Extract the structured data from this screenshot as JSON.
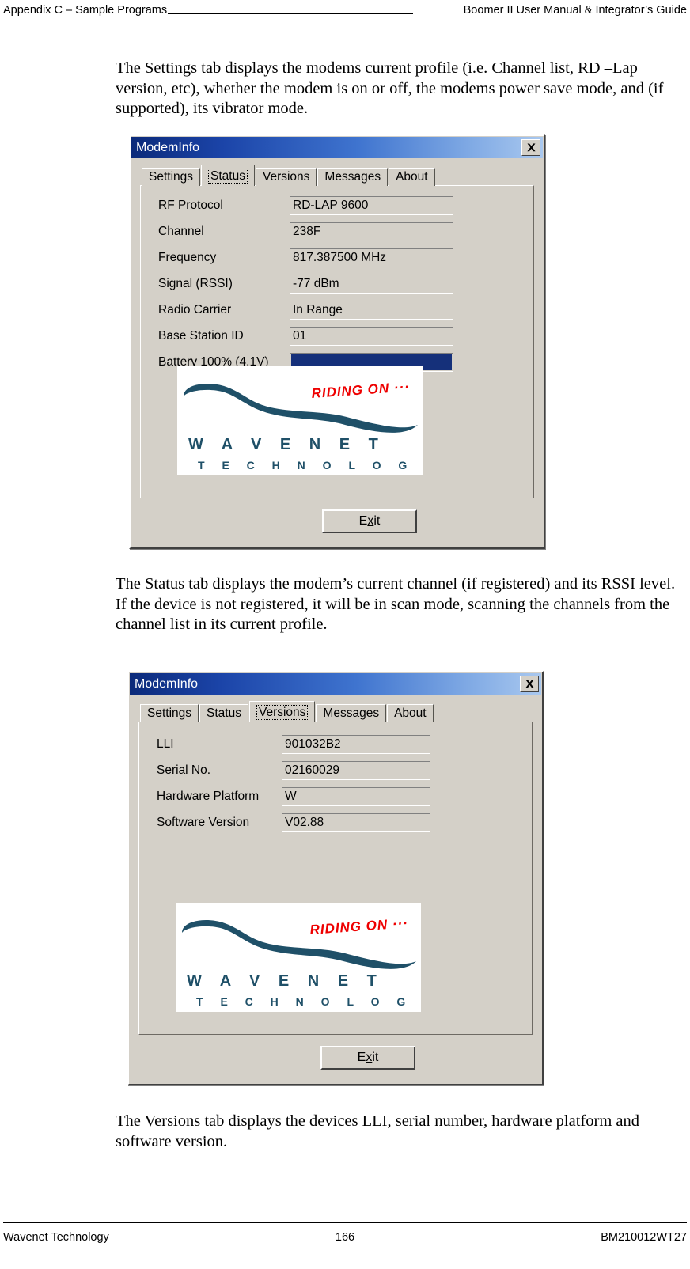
{
  "header": {
    "left": "Appendix C – Sample Programs",
    "rule": "_______________________________",
    "right": "Boomer II User Manual & Integrator’s Guide"
  },
  "paragraphs": {
    "settings": "The Settings tab displays the modems current profile (i.e. Channel list, RD –Lap version, etc), whether the modem is on or off, the modems power save mode, and (if supported), its vibrator mode.",
    "status": "The Status tab displays the modem’s current channel (if registered) and its RSSI level. If the device is not registered, it will be in scan mode, scanning the channels from the channel list in its current profile.",
    "versions": "The Versions tab displays the devices LLI, serial number, hardware platform and software version."
  },
  "dialog_status": {
    "title": "ModemInfo",
    "close_label": "×",
    "tabs": [
      {
        "label": "Settings",
        "active": false
      },
      {
        "label": "Status",
        "active": true
      },
      {
        "label": "Versions",
        "active": false
      },
      {
        "label": "Messages",
        "active": false
      },
      {
        "label": "About",
        "active": false
      }
    ],
    "fields": [
      {
        "label": "RF Protocol",
        "value": "RD-LAP 9600"
      },
      {
        "label": "Channel",
        "value": "238F"
      },
      {
        "label": "Frequency",
        "value": "817.387500 MHz"
      },
      {
        "label": "Signal (RSSI)",
        "value": "-77 dBm"
      },
      {
        "label": "Radio Carrier",
        "value": "In Range"
      },
      {
        "label": "Base Station ID",
        "value": "01"
      }
    ],
    "battery": {
      "label": "Battery 100% (4.1V)",
      "percent": 100,
      "fill_color": "#15307a"
    },
    "exit_label": "Exit",
    "exit_accel": "x"
  },
  "dialog_versions": {
    "title": "ModemInfo",
    "close_label": "×",
    "tabs": [
      {
        "label": "Settings",
        "active": false
      },
      {
        "label": "Status",
        "active": false
      },
      {
        "label": "Versions",
        "active": true
      },
      {
        "label": "Messages",
        "active": false
      },
      {
        "label": "About",
        "active": false
      }
    ],
    "fields": [
      {
        "label": "LLI",
        "value": "901032B2"
      },
      {
        "label": "Serial No.",
        "value": "02160029"
      },
      {
        "label": "Hardware Platform",
        "value": "W"
      },
      {
        "label": "Software Version",
        "value": "V02.88"
      }
    ],
    "exit_label": "Exit",
    "exit_accel": "x"
  },
  "logo": {
    "company": "W A V E N E T",
    "tagline": "T E C H N O L O G Y",
    "slogan": "RIDING ON ...",
    "swoosh_color": "#1f5068",
    "text_color": "#1f5068",
    "slogan_color": "#ee0000"
  },
  "footer": {
    "left": "Wavenet Technology",
    "page": "166",
    "right": "BM210012WT27"
  }
}
